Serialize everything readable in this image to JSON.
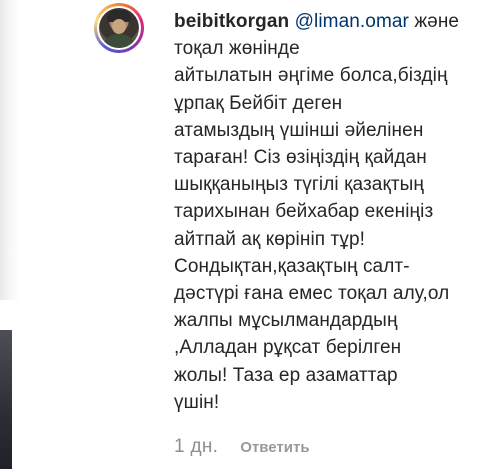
{
  "comment": {
    "username": "beibitkorgan",
    "mention": "@liman.omar",
    "text": "және тоқал жөнінде\nайтылатын әңгіме болса,біздің\nұрпақ Бейбіт деген\nатамыздың үшінші әйелінен\nтараған! Сіз өзіңіздің қайдан\nшыққаныңыз түгілі қазақтың\nтарихынан бейхабар екеніңіз\nайтпай ақ көрініп тұр!\nСондықтан,қазақтың салт-\nдәстүрі ғана емес тоқал алу,ол\nжалпы мұсылмандардың\n,Алладан рұқсат берілген\nжолы! Таза ер азаматтар\nүшін!"
  },
  "meta": {
    "timestamp": "1 дн.",
    "reply_label": "Ответить"
  },
  "icons": {
    "avatar": "profile-photo-with-story-ring"
  },
  "colors": {
    "text": "#262626",
    "mention": "#003569",
    "secondary": "#8e8e8e"
  }
}
